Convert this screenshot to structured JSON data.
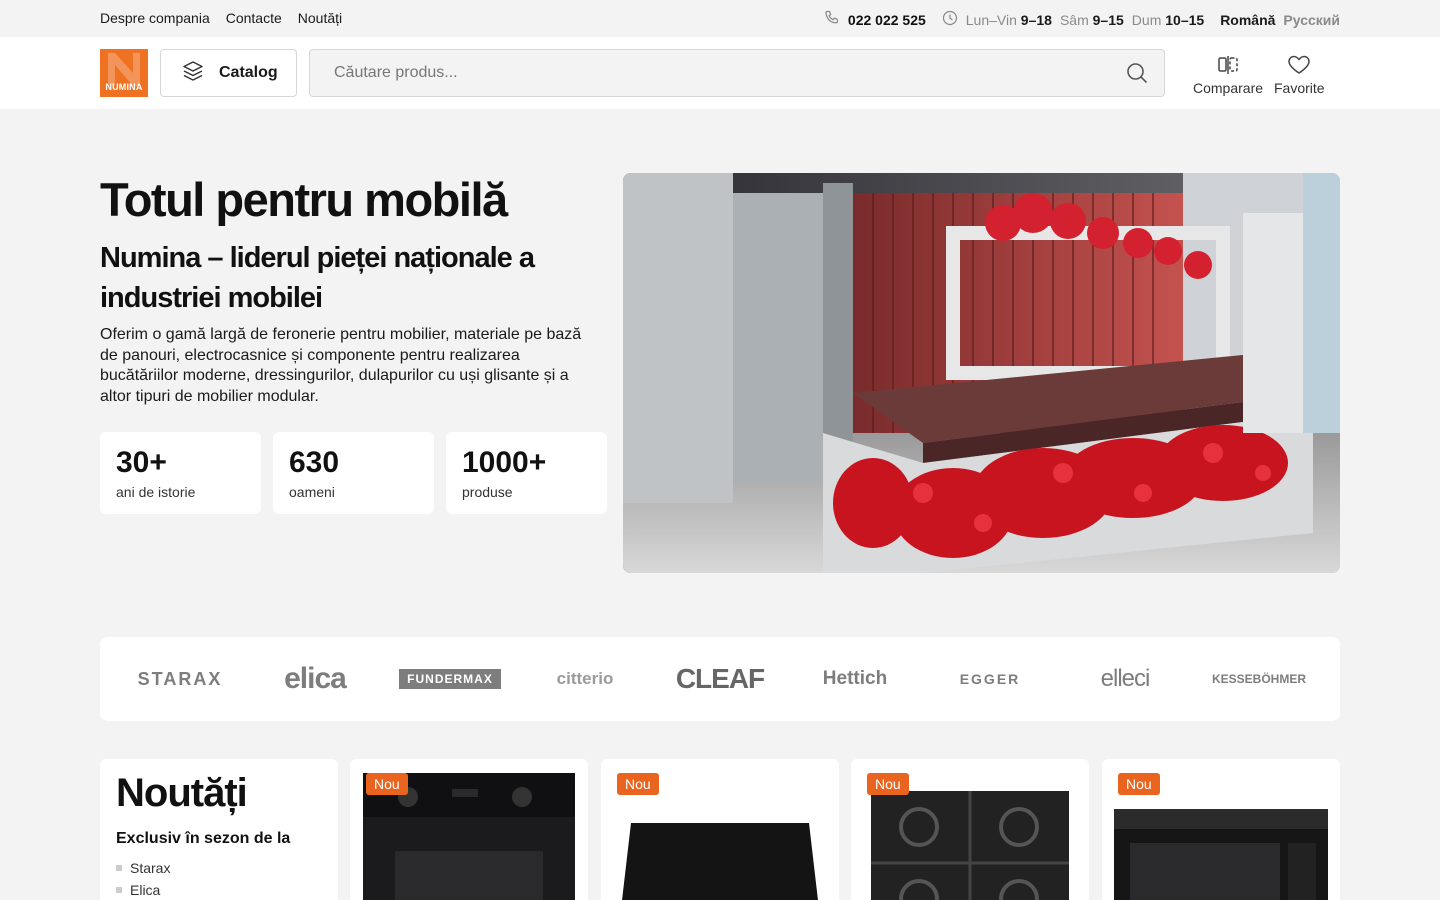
{
  "topbar": {
    "links": [
      "Despre compania",
      "Contacte",
      "Noutăți"
    ],
    "phone": "022 022 525",
    "hours": [
      {
        "label": "Lun–Vin",
        "value": "9–18"
      },
      {
        "label": "Sâm",
        "value": "9–15"
      },
      {
        "label": "Dum",
        "value": "10–15"
      }
    ],
    "lang_active": "Română",
    "lang_other": "Русский"
  },
  "header": {
    "logo_text": "NUMINA",
    "catalog_label": "Catalog",
    "search_placeholder": "Căutare produs...",
    "compare_label": "Comparare",
    "favorites_label": "Favorite"
  },
  "hero": {
    "title": "Totul pentru mobilă",
    "subtitle": "Numina – liderul pieței naționale a industriei mobilei",
    "description": "Oferim o gamă largă de feronerie pentru mobilier, materiale pe bază de panouri, electrocasnice și componente pentru realizarea bucătăriilor moderne, dressingurilor, dulapurilor cu uși glisante și a altor tipuri de mobilier modular.",
    "stats": [
      {
        "value": "30+",
        "label": "ani de istorie"
      },
      {
        "value": "630",
        "label": "oameni"
      },
      {
        "value": "1000+",
        "label": "produse"
      }
    ]
  },
  "brands": [
    "STARAX",
    "elica",
    "FUNDERMAX",
    "citterio",
    "CLEAF",
    "Hettich",
    "EGGER",
    "elleci",
    "KESSEBÖHMER"
  ],
  "novelties": {
    "title": "Noutăți",
    "subtitle": "Exclusiv în sezon de la",
    "brands": [
      "Starax",
      "Elica"
    ],
    "badge": "Nou"
  },
  "colors": {
    "accent": "#e8641f",
    "logo": "#ef7223",
    "background": "#f3f3f3"
  }
}
